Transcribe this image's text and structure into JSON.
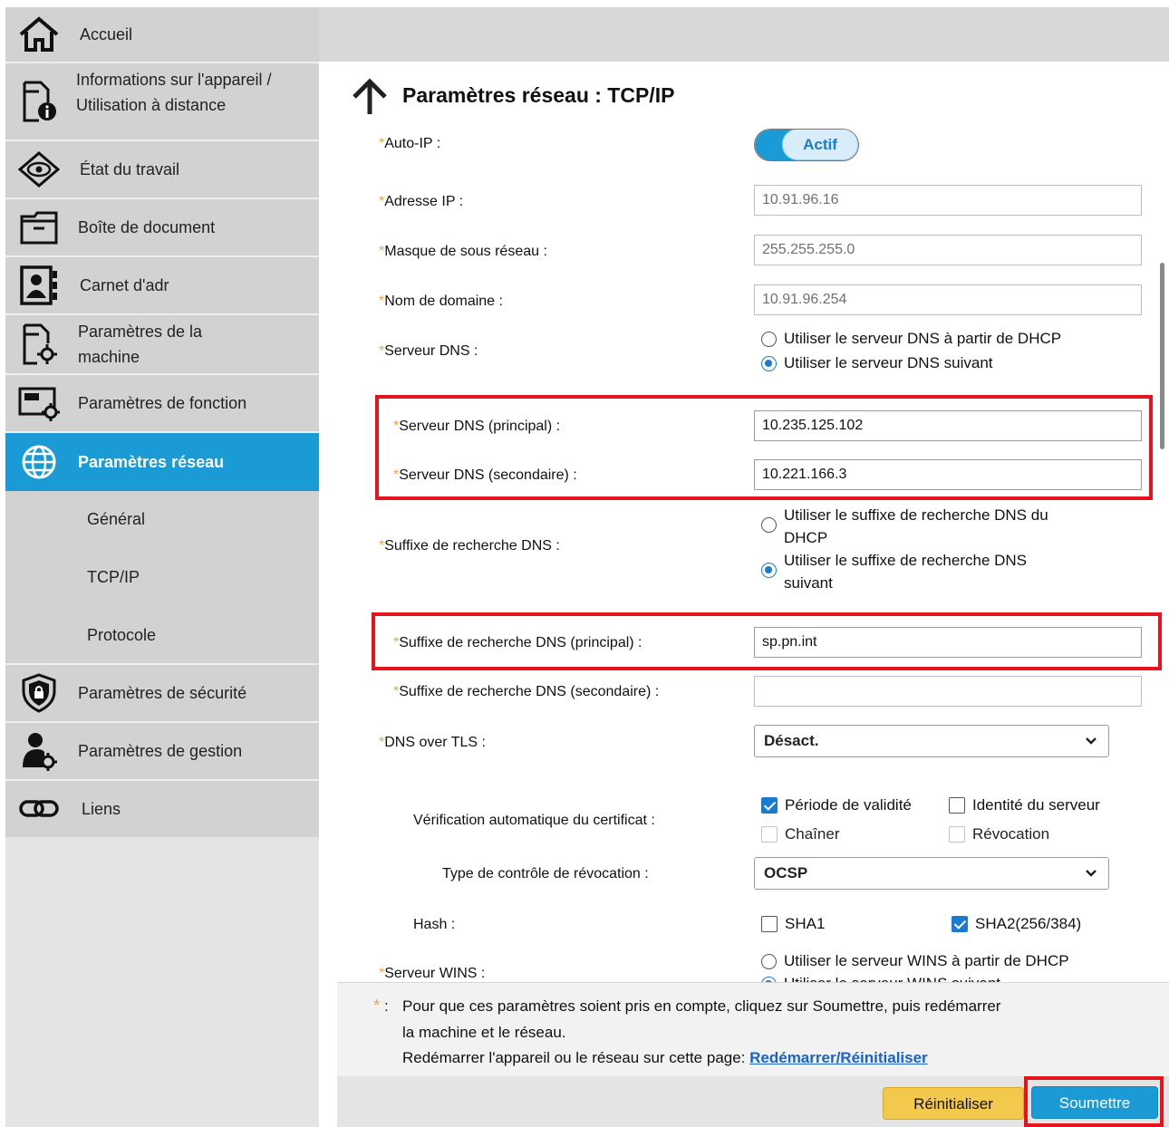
{
  "sidebar": {
    "items": [
      {
        "label": "Accueil",
        "icon": "home-icon"
      },
      {
        "label": "Informations sur l'appareil / Utilisation à distance",
        "icon": "device-info-icon"
      },
      {
        "label": "État du travail",
        "icon": "eye-icon"
      },
      {
        "label": "Boîte de document",
        "icon": "folder-icon"
      },
      {
        "label": "Carnet d'adr",
        "icon": "address-book-icon"
      },
      {
        "label": "Paramètres de la machine",
        "icon": "machine-settings-icon"
      },
      {
        "label": "Paramètres de fonction",
        "icon": "function-settings-icon"
      },
      {
        "label": "Paramètres réseau",
        "icon": "globe-icon"
      },
      {
        "label": "Paramètres de sécurité",
        "icon": "shield-icon"
      },
      {
        "label": "Paramètres de gestion",
        "icon": "user-gear-icon"
      },
      {
        "label": "Liens",
        "icon": "link-icon"
      }
    ],
    "subitems": [
      "Général",
      "TCP/IP",
      "Protocole"
    ]
  },
  "page": {
    "title": "Paramètres réseau : TCP/IP"
  },
  "form": {
    "auto_ip": {
      "label": "Auto-IP :",
      "state": "Actif"
    },
    "ip_address": {
      "label": "Adresse IP :",
      "value": "10.91.96.16"
    },
    "subnet_mask": {
      "label": "Masque de sous réseau :",
      "value": "255.255.255.0"
    },
    "domain_name": {
      "label": "Nom de domaine :",
      "value": "10.91.96.254"
    },
    "dns_server": {
      "label": "Serveur DNS :",
      "options": [
        "Utiliser le serveur DNS à partir de DHCP",
        "Utiliser le serveur DNS suivant"
      ],
      "selected": 1
    },
    "dns_primary": {
      "label": "Serveur DNS (principal) :",
      "value": "10.235.125.102"
    },
    "dns_secondary": {
      "label": "Serveur DNS (secondaire) :",
      "value": "10.221.166.3"
    },
    "dns_suffix": {
      "label": "Suffixe de recherche DNS :",
      "option1_line1": "Utiliser le suffixe de recherche DNS du",
      "option1_line2": "DHCP",
      "option2_line1": "Utiliser le suffixe de recherche DNS",
      "option2_line2": "suivant",
      "selected": 1
    },
    "dns_suffix_primary": {
      "label": "Suffixe de recherche DNS (principal) :",
      "value": "sp.pn.int"
    },
    "dns_suffix_secondary": {
      "label": "Suffixe de recherche DNS (secondaire) :",
      "value": ""
    },
    "dns_over_tls": {
      "label": "DNS over TLS :",
      "value": "Désact."
    },
    "cert_check": {
      "label": "Vérification automatique du certificat :",
      "validity": "Période de validité",
      "server_identity": "Identité du serveur",
      "chain": "Chaîner",
      "revocation": "Révocation"
    },
    "revocation_type": {
      "label": "Type de contrôle de révocation :",
      "value": "OCSP"
    },
    "hash": {
      "label": "Hash :",
      "sha1": "SHA1",
      "sha2": "SHA2(256/384)"
    },
    "wins_server": {
      "label": "Serveur WINS :",
      "option1": "Utiliser le serveur WINS à partir de DHCP",
      "option2": "Utiliser le serveur WINS suivant"
    }
  },
  "note": {
    "star": "*",
    "colon": ":",
    "line1": "Pour que ces paramètres soient pris en compte, cliquez sur Soumettre, puis redémarrer",
    "line2": "la machine et le réseau.",
    "line3": "Redémarrer l'appareil ou le réseau sur cette page: ",
    "link": "Redémarrer/Réinitialiser"
  },
  "buttons": {
    "reset": "Réinitialiser",
    "submit": "Soumettre"
  },
  "colors": {
    "accent": "#1a9bd6",
    "highlight": "#e3141e",
    "required_star": "#e8a64b",
    "reset_button": "#f2c94c"
  }
}
